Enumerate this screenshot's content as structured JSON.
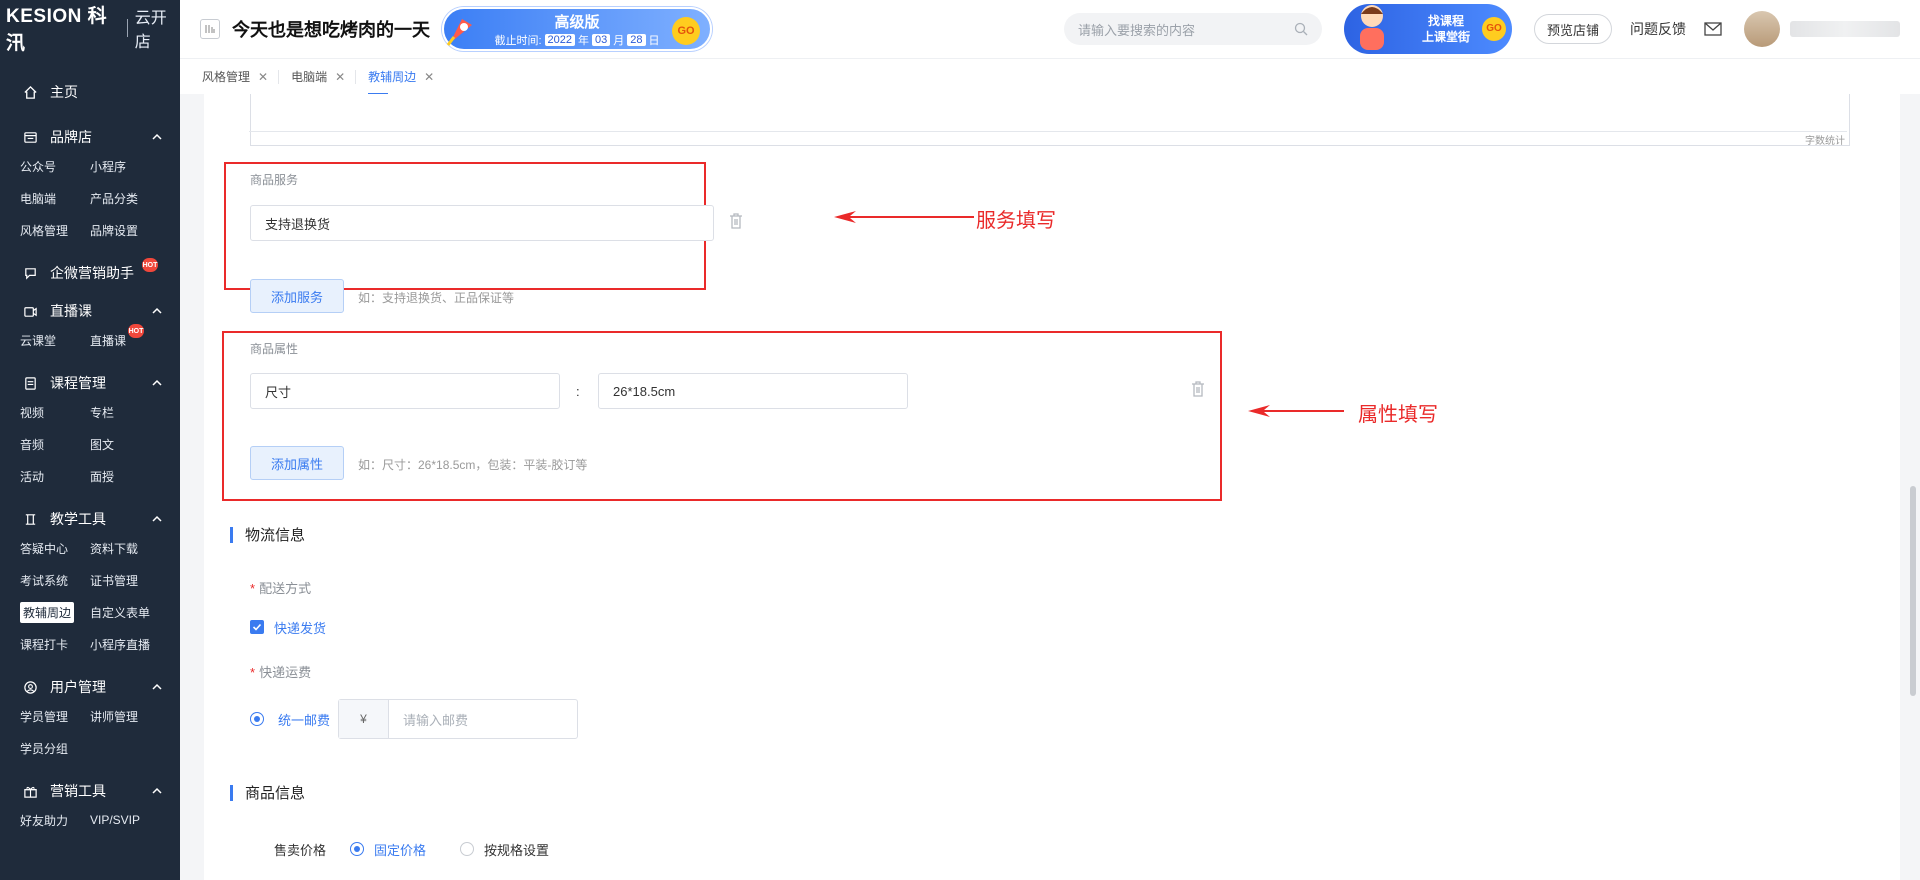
{
  "brand": {
    "logo": "KESION 科汛",
    "sub": "云开店"
  },
  "sidebar": {
    "home": "主页",
    "sections": [
      {
        "title": "品牌店",
        "icon": "store-icon",
        "items": [
          {
            "label": "公众号"
          },
          {
            "label": "小程序"
          },
          {
            "label": "电脑端"
          },
          {
            "label": "产品分类"
          },
          {
            "label": "风格管理"
          },
          {
            "label": "品牌设置"
          }
        ]
      },
      {
        "title": "企微营销助手",
        "icon": "chat-icon",
        "hot": true,
        "items": []
      },
      {
        "title": "直播课",
        "icon": "video-icon",
        "items": [
          {
            "label": "云课堂"
          },
          {
            "label": "直播课",
            "hot": true
          }
        ]
      },
      {
        "title": "课程管理",
        "icon": "book-icon",
        "items": [
          {
            "label": "视频"
          },
          {
            "label": "专栏"
          },
          {
            "label": "音频"
          },
          {
            "label": "图文"
          },
          {
            "label": "活动"
          },
          {
            "label": "面授"
          }
        ]
      },
      {
        "title": "教学工具",
        "icon": "tools-icon",
        "items": [
          {
            "label": "答疑中心"
          },
          {
            "label": "资料下载"
          },
          {
            "label": "考试系统"
          },
          {
            "label": "证书管理"
          },
          {
            "label": "教辅周边",
            "active": true
          },
          {
            "label": "自定义表单"
          },
          {
            "label": "课程打卡"
          },
          {
            "label": "小程序直播"
          }
        ]
      },
      {
        "title": "用户管理",
        "icon": "user-icon",
        "items": [
          {
            "label": "学员管理"
          },
          {
            "label": "讲师管理"
          },
          {
            "label": "学员分组"
          }
        ]
      },
      {
        "title": "营销工具",
        "icon": "gift-icon",
        "items": [
          {
            "label": "好友助力"
          },
          {
            "label": "VIP/SVIP"
          }
        ]
      }
    ],
    "hot_label": "HOT"
  },
  "header": {
    "title": "今天也是想吃烤肉的一天",
    "vip": {
      "level": "高级版",
      "expire_prefix": "截止时间:",
      "year": "2022",
      "year_unit": "年",
      "month": "03",
      "month_unit": "月",
      "day": "28",
      "day_unit": "日",
      "go": "GO"
    },
    "search_placeholder": "请输入要搜索的内容",
    "promo": {
      "line1": "找课程",
      "line2": "上课堂街",
      "go": "GO"
    },
    "preview": "预览店铺",
    "feedback": "问题反馈"
  },
  "tabs": [
    {
      "label": "风格管理",
      "active": false
    },
    {
      "label": "电脑端",
      "active": false
    },
    {
      "label": "教辅周边",
      "active": true
    }
  ],
  "form": {
    "word_count": "字数统计",
    "service": {
      "label": "商品服务",
      "value": "支持退换货",
      "add": "添加服务",
      "hint": "如：支持退换货、正品保证等"
    },
    "attribute": {
      "label": "商品属性",
      "name": "尺寸",
      "separator": ":",
      "value": "26*18.5cm",
      "add": "添加属性",
      "hint": "如：尺寸：26*18.5cm，包装：平装-胶订等"
    },
    "annotations": {
      "service": "服务填写",
      "attribute": "属性填写"
    },
    "logistics": {
      "title": "物流信息",
      "delivery_label": "配送方式",
      "delivery_option": "快递发货",
      "fee_label": "快递运费",
      "fee_option": "统一邮费",
      "currency": "¥",
      "fee_placeholder": "请输入邮费",
      "required_mark": "*"
    },
    "product": {
      "title": "商品信息",
      "price_label": "售卖价格",
      "fixed": "固定价格",
      "by_spec": "按规格设置"
    }
  },
  "colors": {
    "accent": "#3a7bf0",
    "annotation": "#ea2a2a",
    "sidebar": "#1f2b3b"
  }
}
